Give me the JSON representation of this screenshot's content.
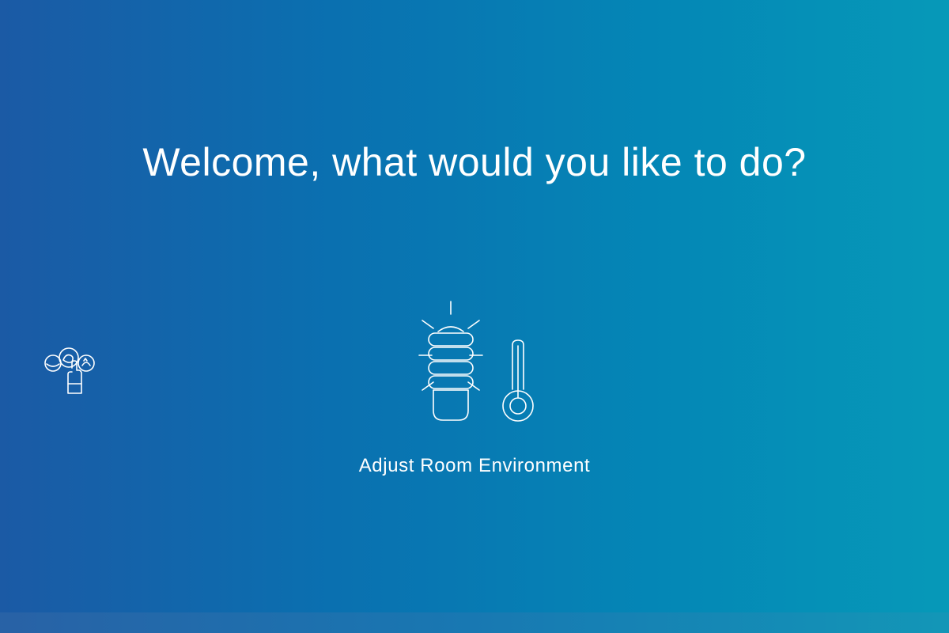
{
  "screen": {
    "title": "Welcome, what would you like to do?",
    "background_gradient": [
      "#1b5aa5",
      "#0a70b0",
      "#0487b6",
      "#0699b8"
    ]
  },
  "tiles": [
    {
      "label": "Adjust Room Environment",
      "icons": [
        "light-bulb-icon",
        "thermometer-icon"
      ]
    }
  ],
  "side_widget": {
    "icon": "meal-service-icon"
  }
}
